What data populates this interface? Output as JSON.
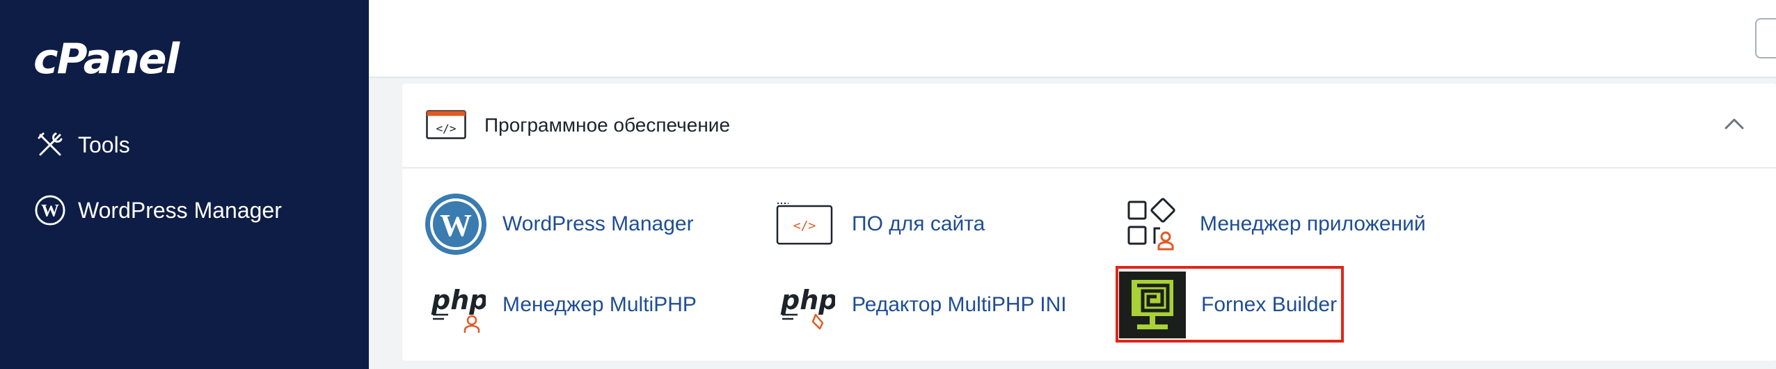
{
  "sidebar": {
    "logo": "cPanel",
    "items": [
      {
        "label": "Tools",
        "icon": "tools-icon"
      },
      {
        "label": "WordPress Manager",
        "icon": "wordpress-icon"
      }
    ]
  },
  "section": {
    "title": "Программное обеспечение",
    "icon": "code-window-icon",
    "collapse_icon": "chevron-up-icon"
  },
  "apps": [
    {
      "label": "WordPress Manager",
      "icon": "wordpress-logo-icon"
    },
    {
      "label": "ПО для сайта",
      "icon": "code-window-icon"
    },
    {
      "label": "Менеджер приложений",
      "icon": "app-manager-icon"
    },
    {
      "label": "Менеджер MultiPHP",
      "icon": "php-manager-icon",
      "icon_text": "php"
    },
    {
      "label": "Редактор MultiPHP INI",
      "icon": "php-editor-icon",
      "icon_text": "php"
    },
    {
      "label": "Fornex Builder",
      "icon": "fornex-builder-icon"
    }
  ],
  "colors": {
    "sidebar_bg": "#0e1d45",
    "link": "#1e4d96",
    "accent_orange": "#e05a24",
    "highlight": "#e0261b",
    "fornex_green": "#a8d236"
  }
}
